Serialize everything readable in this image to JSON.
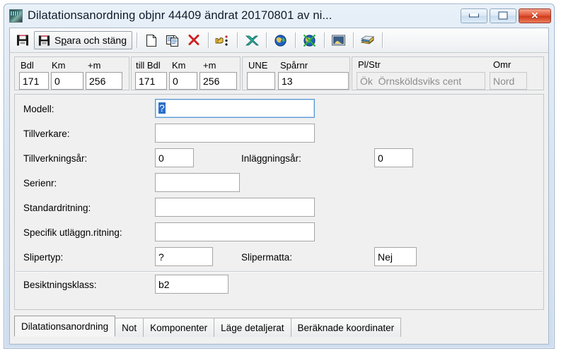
{
  "window": {
    "title": "Dilatationsanordning  objnr 44409 ändrat 20170801 av ni...",
    "app_icon": "photo-icon",
    "controls": {
      "minimize": "minimize-icon",
      "restore": "restore-icon",
      "close": "✕"
    }
  },
  "toolbar": {
    "save_icon": "save-icon",
    "save_close_icon": "save-icon",
    "save_close_label_pre": "S",
    "save_close_label_accel": "p",
    "save_close_label_post": "ara och stäng",
    "save_close_label": "Spara och stäng",
    "new_icon": "new-document-icon",
    "copy_icon": "copy-icon",
    "delete_icon": "delete-x-icon",
    "hand_icon": "pointing-hand-icon",
    "excel_icon": "excel-export-icon",
    "globe_icon": "globe-icon",
    "globe_x_icon": "globe-cancel-icon",
    "image_icon": "image-icon",
    "books_icon": "books-icon"
  },
  "location": {
    "group1": {
      "labels": [
        "Bdl",
        "Km",
        "+m"
      ],
      "values": [
        "171",
        "0",
        "256"
      ]
    },
    "group2": {
      "labels": [
        "till Bdl",
        "Km",
        "+m"
      ],
      "values": [
        "171",
        "0",
        "256"
      ]
    },
    "group3": {
      "labels": [
        "UNE",
        "Spårnr"
      ],
      "values": [
        "",
        "13"
      ]
    },
    "group4": {
      "labels": [
        "Pl/Str",
        "Omr"
      ],
      "values": [
        "Ök  Örnsköldsviks cent",
        "Nord"
      ]
    }
  },
  "form": {
    "modell": {
      "label": "Modell:",
      "value": "?"
    },
    "tillverkare": {
      "label": "Tillverkare:",
      "value": ""
    },
    "tillverkningsar": {
      "label": "Tillverkningsår:",
      "value": "0"
    },
    "inlaggningsar": {
      "label": "Inläggningsår:",
      "value": "0"
    },
    "serienr": {
      "label": "Serienr:",
      "value": ""
    },
    "standardritning": {
      "label": "Standardritning:",
      "value": ""
    },
    "specifik": {
      "label": "Specifik utläggn.ritning:",
      "value": ""
    },
    "slipertyp": {
      "label": "Slipertyp:",
      "value": "?"
    },
    "slipermatta": {
      "label": "Slipermatta:",
      "value": "Nej"
    },
    "besiktningsklass": {
      "label": "Besiktningsklass:",
      "value": "b2"
    }
  },
  "tabs": [
    {
      "label": "Dilatationsanordning",
      "active": true
    },
    {
      "label": "Not",
      "active": false
    },
    {
      "label": "Komponenter",
      "active": false
    },
    {
      "label": "Läge detaljerat",
      "active": false
    },
    {
      "label": "Beräknade koordinater",
      "active": false
    }
  ],
  "colors": {
    "accent": "#2a6fc9",
    "close_button": "#cf3c1c",
    "title_bar": "#d7e4f2",
    "panel": "#f0f0f0"
  }
}
